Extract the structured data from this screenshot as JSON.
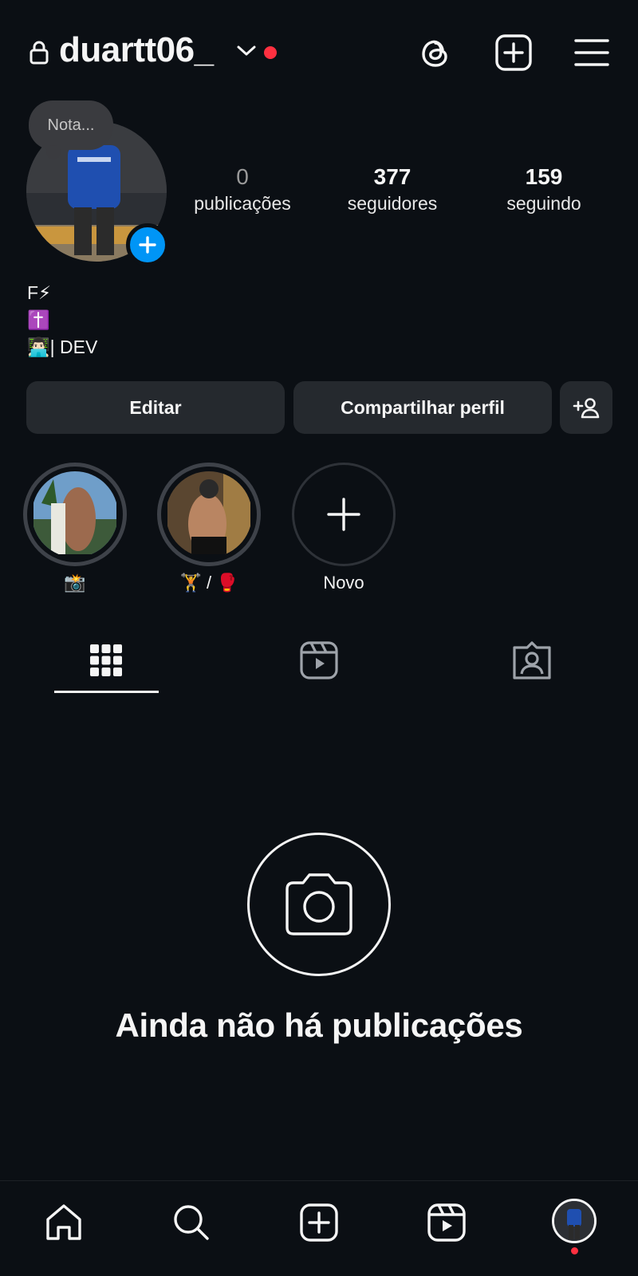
{
  "header": {
    "username": "duartt06_"
  },
  "profile": {
    "note": "Nota...",
    "stats": {
      "posts": {
        "value": "0",
        "label": "publicações"
      },
      "followers": {
        "value": "377",
        "label": "seguidores"
      },
      "following": {
        "value": "159",
        "label": "seguindo"
      }
    },
    "bio": [
      "F⚡",
      "✝️",
      "👨🏻‍💻| DEV"
    ]
  },
  "actions": {
    "edit_label": "Editar",
    "share_label": "Compartilhar perfil"
  },
  "highlights": [
    {
      "label": "📸"
    },
    {
      "label": "🏋️ / 🥊"
    },
    {
      "label": "Novo"
    }
  ],
  "tabs": [
    "grid-icon",
    "reels-icon",
    "tagged-icon"
  ],
  "empty_state": {
    "title": "Ainda não há publicações"
  },
  "colors": {
    "background": "#0b0f14",
    "accent": "#0095f6",
    "notification": "#ff3040",
    "button": "#25292e"
  }
}
